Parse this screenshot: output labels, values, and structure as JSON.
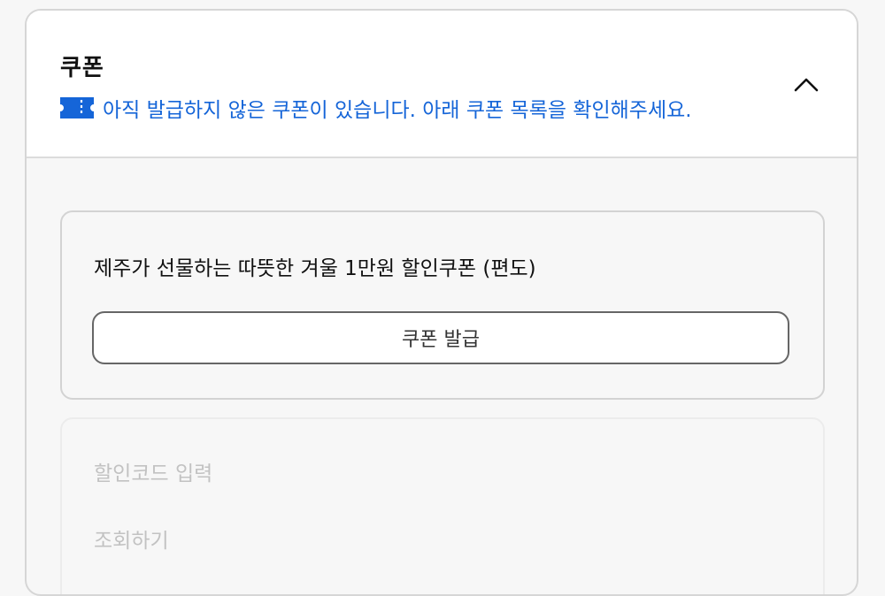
{
  "coupon_section": {
    "title": "쿠폰",
    "notice": "아직 발급하지 않은 쿠폰이 있습니다. 아래 쿠폰 목록을 확인해주세요.",
    "notice_color": "#1565d8",
    "notice_icon": "ticket-icon",
    "toggle_icon": "chevron-up-icon"
  },
  "coupon_card": {
    "name": "제주가 선물하는 따뜻한 겨울 1만원 할인쿠폰 (편도)",
    "issue_button_label": "쿠폰 발급"
  },
  "discount_code": {
    "input_label": "할인코드 입력",
    "lookup_label": "조회하기"
  }
}
